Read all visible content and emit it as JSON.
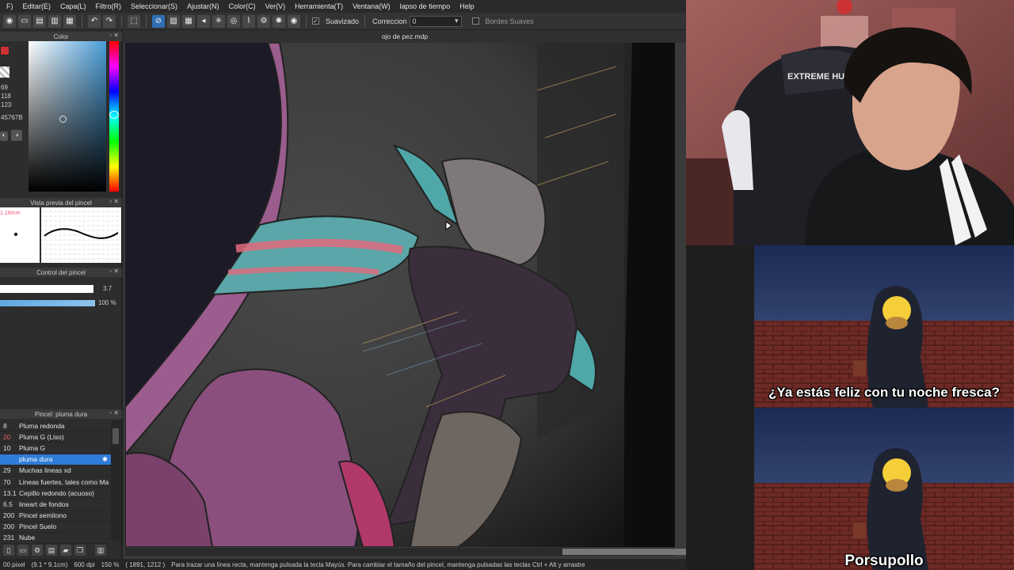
{
  "menu": [
    "F)",
    "Editar(E)",
    "Capa(L)",
    "Filtro(R)",
    "Seleccionar(S)",
    "Ajustar(N)",
    "Color(C)",
    "Ver(V)",
    "Herramienta(T)",
    "Ventana(W)",
    "lapso de tiempo",
    "Help"
  ],
  "toolbar": {
    "suavizado_label": "Suavizado",
    "correccion_label": "Correccion",
    "correccion_value": "0",
    "bordes_label": "Bordes Suaves"
  },
  "color_panel": {
    "title": "Color",
    "r": "69",
    "g": "118",
    "b": "123",
    "hex": "45767B"
  },
  "brush_preview": {
    "title": "Vista previa del pincel",
    "size": "1.16mm"
  },
  "brush_control": {
    "title": "Control del pincel",
    "size_value": "3.7",
    "opacity_value": "100 %"
  },
  "brush_list": {
    "title": "Pincel: pluma dura",
    "items": [
      {
        "num": "8",
        "name": "Pluma redonda",
        "red": false
      },
      {
        "num": "20",
        "name": "Pluma G (Liso)",
        "red": true
      },
      {
        "num": "10",
        "name": "Pluma G",
        "red": false
      },
      {
        "num": "",
        "name": "pluma dura",
        "red": false,
        "selected": true
      },
      {
        "num": "29",
        "name": "Muchas lineas xd",
        "red": false
      },
      {
        "num": "70",
        "name": "Lineas fuertes, tales como Ma",
        "red": false
      },
      {
        "num": "13.1",
        "name": "Cepillo redondo (acuoso)",
        "red": false
      },
      {
        "num": "6.5",
        "name": "lineart de fondos",
        "red": false
      },
      {
        "num": "200",
        "name": "Pincel semitono",
        "red": false
      },
      {
        "num": "200",
        "name": "Pincel Suelo",
        "red": false
      },
      {
        "num": "231",
        "name": "Nube",
        "red": false
      }
    ]
  },
  "document": {
    "title": "ojo de pez.mdp"
  },
  "status": {
    "size": "00 pixel",
    "dims": "(9.1 * 9.1cm)",
    "dpi": "600 dpi",
    "zoom": "150 %",
    "coords": "( 1891, 1212 )",
    "hint": "Para trazar una línea recta, mantenga pulsada la tecla Mayús. Para cambiar el tamaño del pincel, mantenga pulsadas las teclas Ctrl + Alt y arrastre"
  },
  "webcam": {
    "chair_text": "EXTREME HUNTER"
  },
  "meme": {
    "caption_top": "¿Ya estás feliz con tu noche fresca?",
    "caption_bottom": "Porsupollo"
  },
  "colors": {
    "accent": "#2f7dd8",
    "current_color": "#45767B"
  }
}
